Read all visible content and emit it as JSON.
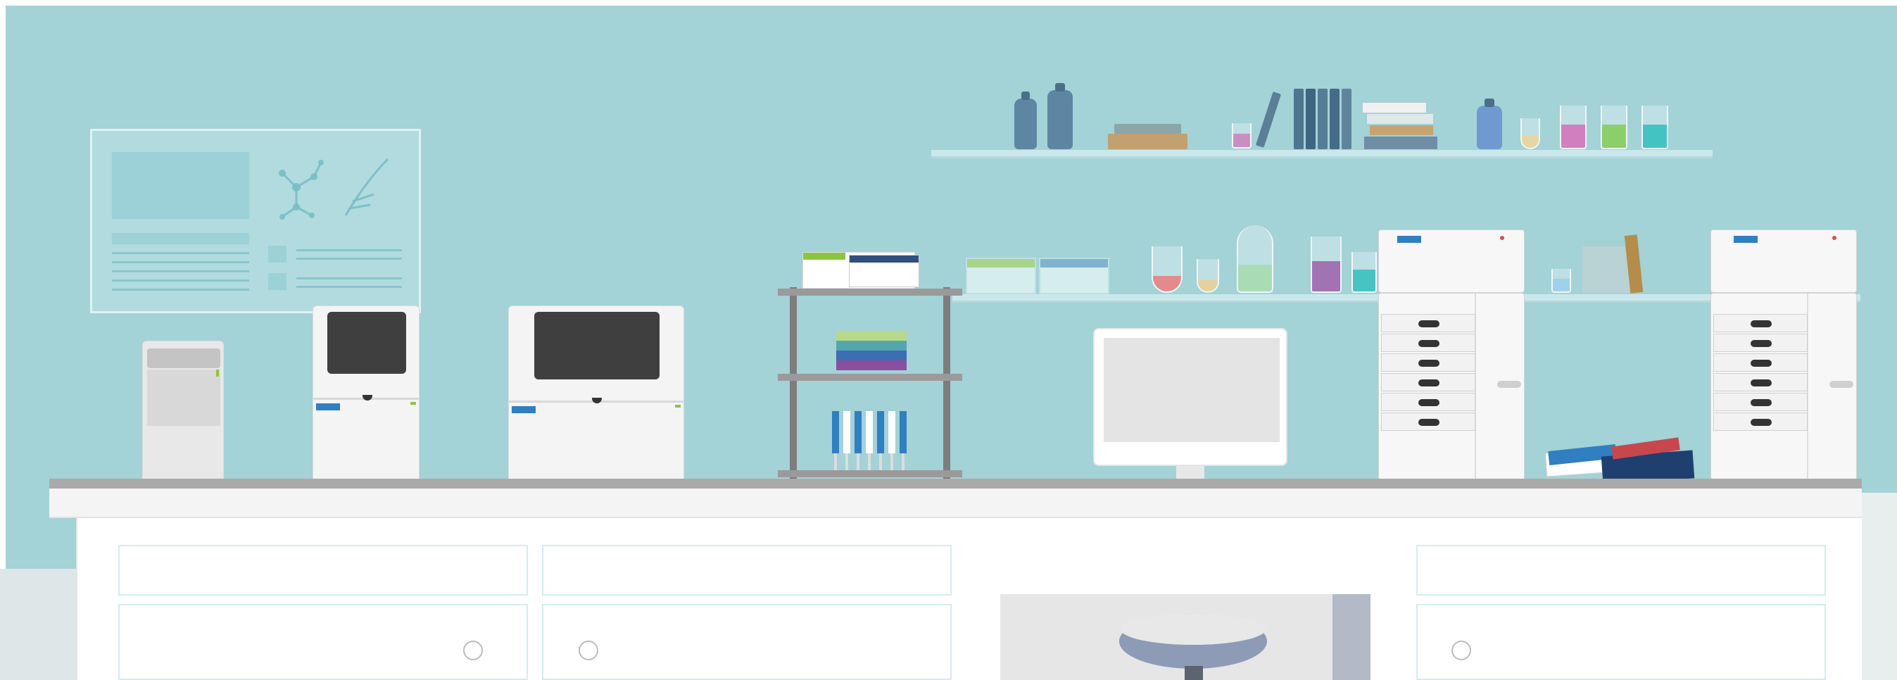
{
  "scene": {
    "wall_color": "#a3d2d7",
    "bench_color": "#f4f4f4",
    "accent_blue": "#2f7fc1",
    "accent_green": "#8cc63f"
  },
  "icons": {
    "poster": "molecule-poster-icon",
    "monitor": "computer-monitor-icon",
    "stool": "lab-stool-icon"
  }
}
